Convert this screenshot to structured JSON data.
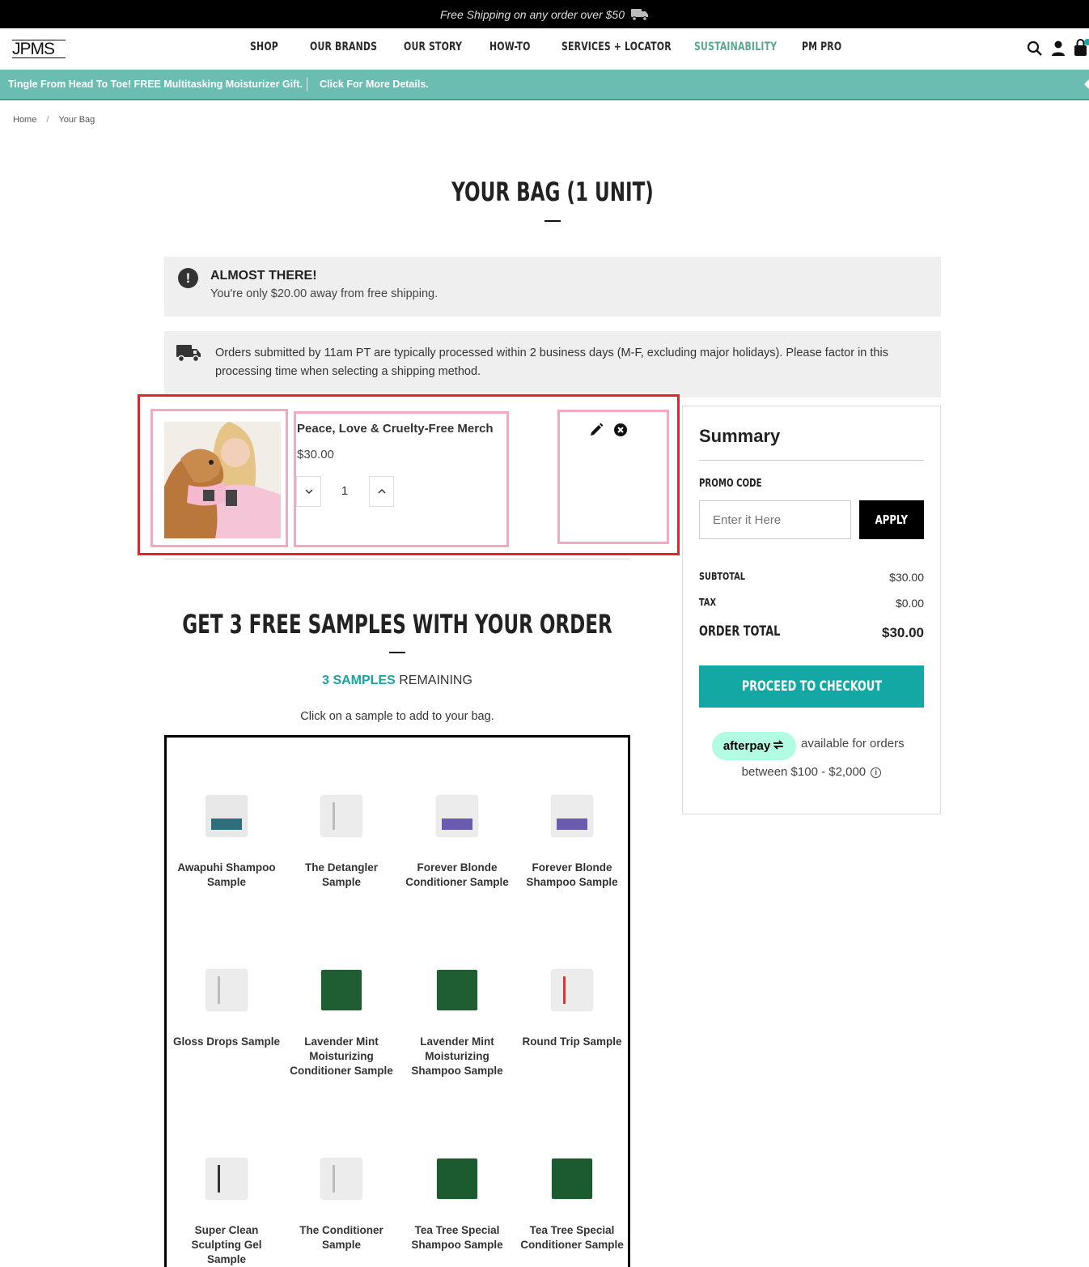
{
  "topbar": {
    "text": "Free Shipping on any order over $50",
    "icon": "truck-icon"
  },
  "header": {
    "logo": "JPMS",
    "nav": [
      {
        "label": "SHOP"
      },
      {
        "label": "OUR BRANDS"
      },
      {
        "label": "OUR STORY"
      },
      {
        "label": "HOW-TO"
      },
      {
        "label": "SERVICES + LOCATOR"
      },
      {
        "label": "SUSTAINABILITY"
      },
      {
        "label": "PM PRO"
      }
    ],
    "icons": [
      "search-icon",
      "account-icon",
      "bag-icon"
    ]
  },
  "promo_bar": {
    "text": "Tingle From Head To Toe! FREE Multitasking Moisturizer Gift.",
    "link": "Click For More Details.",
    "color": "#6bbcb1"
  },
  "breadcrumb": {
    "home": "Home",
    "separator": "/",
    "current": "Your Bag"
  },
  "page_title": "YOUR BAG (1 UNIT)",
  "alerts": {
    "almost_title": "ALMOST THERE!",
    "almost_text": "You're only $20.00 away from free shipping.",
    "processing_text": "Orders submitted by 11am PT are typically processed within 2 business days (M-F, excluding major holidays). Please factor in this processing time when selecting a shipping method."
  },
  "cart": {
    "items": [
      {
        "name": "Peace, Love & Cruelty-Free Merch",
        "price": "$30.00",
        "quantity": "1"
      }
    ]
  },
  "samples": {
    "title": "GET 3 FREE SAMPLES WITH YOUR ORDER",
    "remaining_count": "3 SAMPLES",
    "remaining_label": "REMAINING",
    "hint": "Click on a sample to add to your bag.",
    "items": [
      {
        "name": "Awapuhi Shampoo Sample",
        "color": "#2e6f7d"
      },
      {
        "name": "The Detangler Sample",
        "color": "#e4e4e4"
      },
      {
        "name": "Forever Blonde Conditioner Sample",
        "color": "#6a5bb0"
      },
      {
        "name": "Forever Blonde Shampoo Sample",
        "color": "#6a5bb0"
      },
      {
        "name": "Gloss Drops Sample",
        "color": "#e6e6e6"
      },
      {
        "name": "Lavender Mint Moisturizing Conditioner Sample",
        "color": "#1f5e33"
      },
      {
        "name": "Lavender Mint Moisturizing Shampoo Sample",
        "color": "#1f5e33"
      },
      {
        "name": "Round Trip Sample",
        "color": "#e6e6e6"
      },
      {
        "name": "Super Clean Sculpting Gel Sample",
        "color": "#e6e6e6"
      },
      {
        "name": "The Conditioner Sample",
        "color": "#e6e6e6"
      },
      {
        "name": "Tea Tree Special Shampoo Sample",
        "color": "#1c5a2f"
      },
      {
        "name": "Tea Tree Special Conditioner Sample",
        "color": "#1c5a2f"
      }
    ]
  },
  "summary": {
    "title": "Summary",
    "promo_label": "PROMO CODE",
    "promo_placeholder": "Enter it Here",
    "apply": "APPLY",
    "subtotal_label": "SUBTOTAL",
    "subtotal": "$30.00",
    "tax_label": "TAX",
    "tax": "$0.00",
    "total_label": "ORDER TOTAL",
    "total": "$30.00",
    "checkout": "PROCEED TO CHECKOUT",
    "checkout_color": "#13a8a4",
    "afterpay_logo": "afterpay",
    "afterpay_text1": "available for orders",
    "afterpay_text2": "between $100 - $2,000"
  }
}
